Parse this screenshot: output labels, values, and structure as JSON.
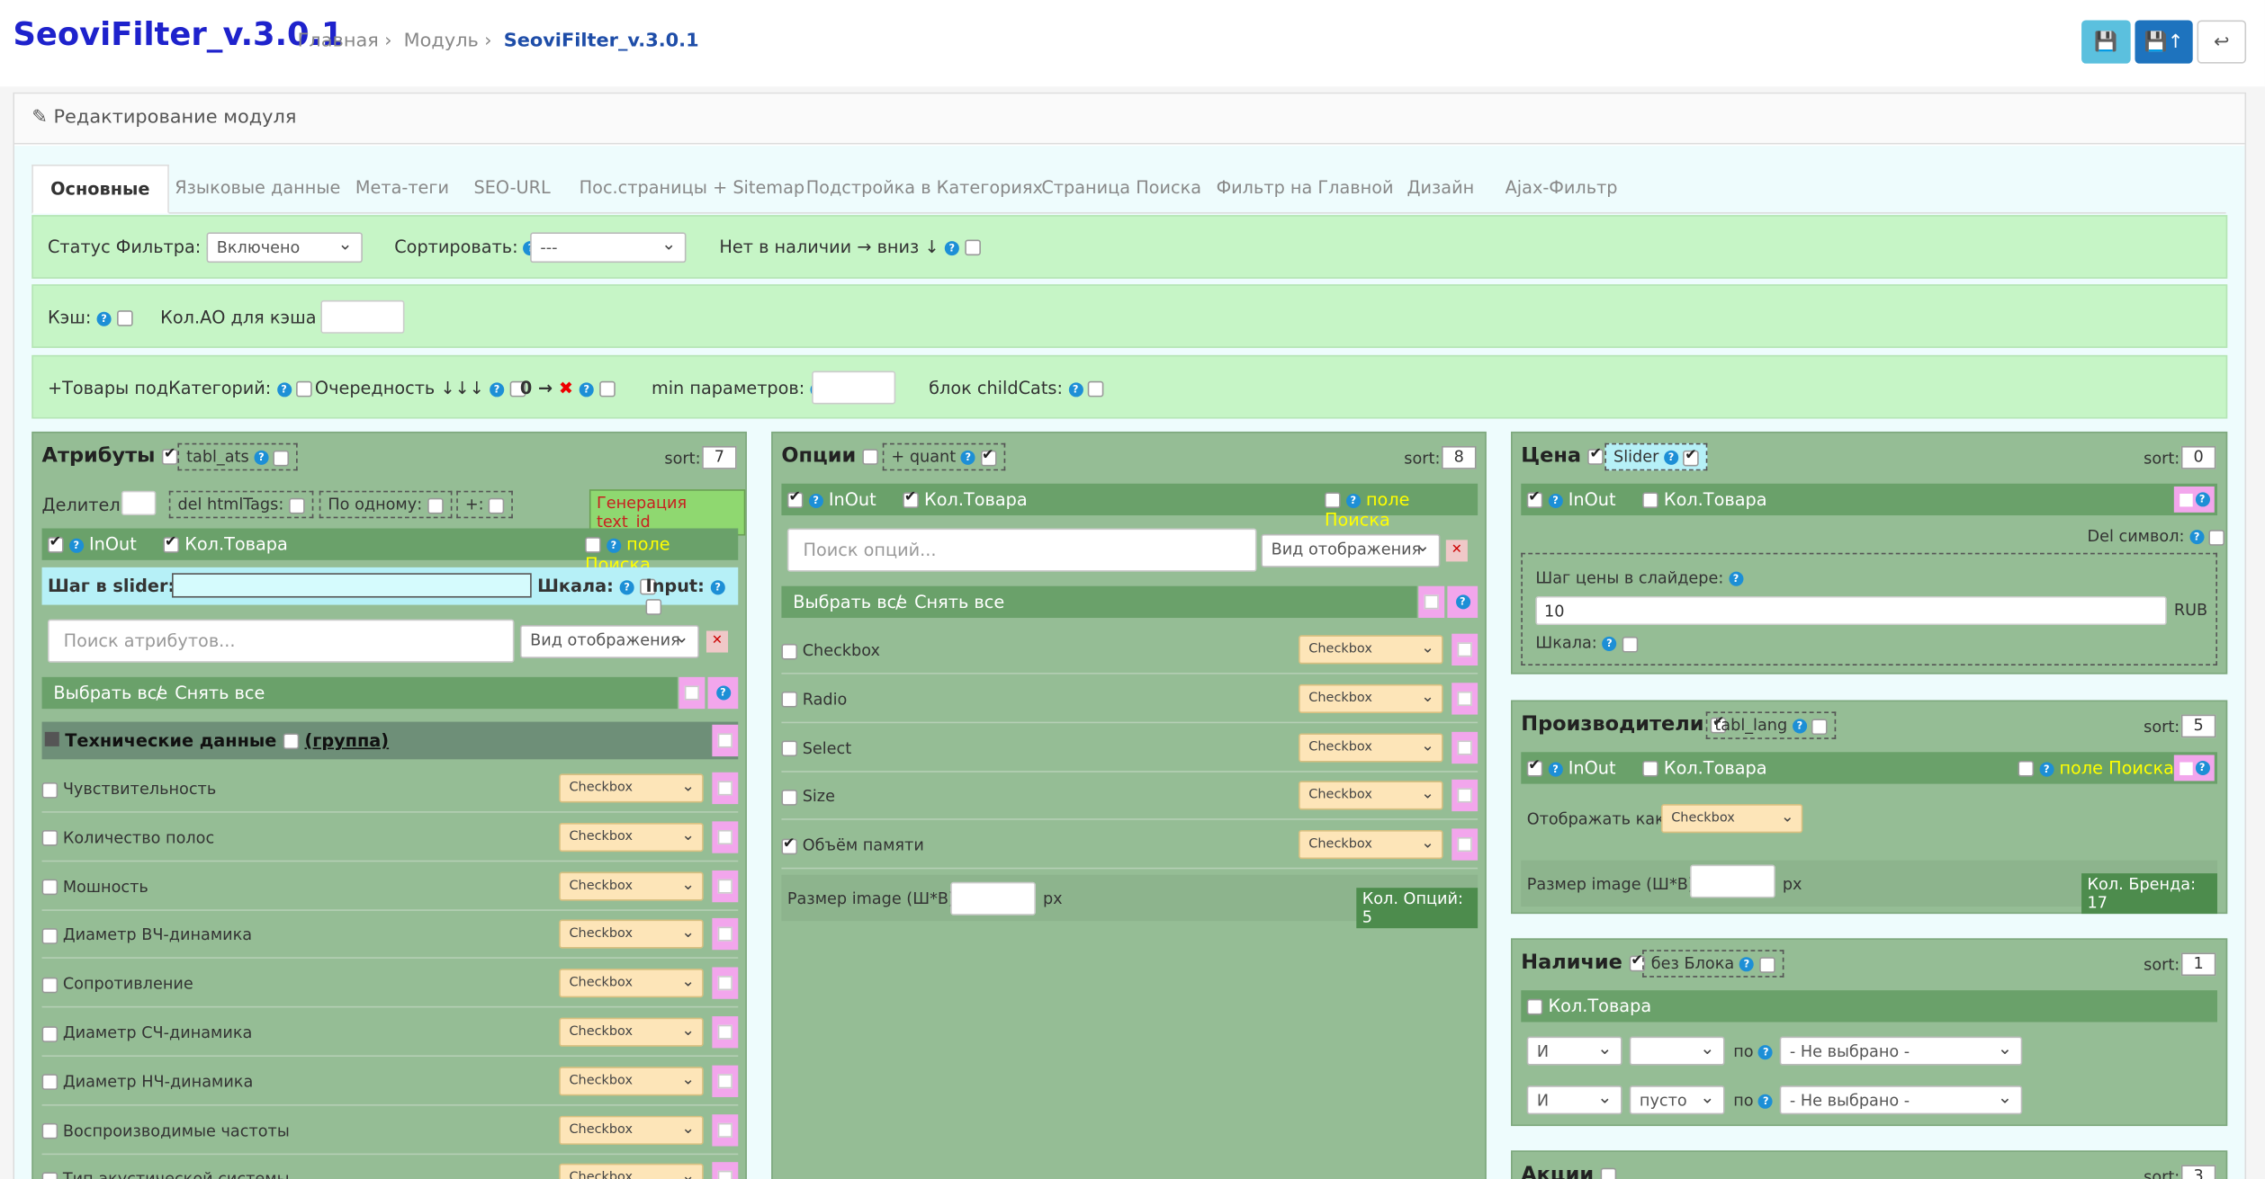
{
  "header": {
    "title": "SeoviFilter_v.3.0.1",
    "breadcrumbs": [
      "Главная",
      "Модуль",
      "SeoviFilter_v.3.0.1"
    ]
  },
  "panel": {
    "title": "Редактирование модуля"
  },
  "tabs": [
    "Основные",
    "Языковые данные",
    "Мета-теги",
    "SEO-URL",
    "Пос.страницы + Sitemap",
    "Подстройка в Категориях",
    "Страница Поиска",
    "Фильтр на Главной",
    "Дизайн",
    "Ajax-Фильтр"
  ],
  "settings": {
    "status_label": "Статус Фильтра:",
    "status_value": "Включено",
    "sort_label": "Сортировать:",
    "sort_value": "---",
    "out_of_stock_label": "Нет в наличии → вниз ↓",
    "cache_label": "Кэш:",
    "cache_count_label": "Кол.АО для кэша",
    "subcats_label": "+Товары подКатегорий:",
    "order_label": "Очередность ↓↓↓",
    "zero_label": "0 →",
    "min_params_label": "min параметров:",
    "child_cats_label": "блок childCats:"
  },
  "attributes": {
    "title": "Атрибуты",
    "tabl": "tabl_ats",
    "sort_label": "sort:",
    "sort": "7",
    "divider_label": "Делитель",
    "del_html": "del htmlTags:",
    "one_by_one": "По одному:",
    "plus": "+:",
    "gen_button": "Генерация text_id",
    "inout": "InOut",
    "count": "Кол.Товара",
    "search_field": "поле Поиска",
    "slider_step": "Шаг в slider:",
    "scale": "Шкала:",
    "input": "Input:",
    "search_placeholder": "Поиск атрибутов...",
    "view_placeholder": "Вид отображения",
    "select_all": "Выбрать все",
    "deselect_all": "Снять все",
    "group_name": "Технические данные",
    "group_label": "(группа)",
    "items": [
      {
        "name": "Чувствительность",
        "type": "Checkbox"
      },
      {
        "name": "Количество полос",
        "type": "Checkbox"
      },
      {
        "name": "Мошность",
        "type": "Checkbox"
      },
      {
        "name": "Диаметр ВЧ-динамика",
        "type": "Checkbox"
      },
      {
        "name": "Сопротивление",
        "type": "Checkbox"
      },
      {
        "name": "Диаметр СЧ-динамика",
        "type": "Checkbox"
      },
      {
        "name": "Диаметр НЧ-динамика",
        "type": "Checkbox"
      },
      {
        "name": "Воспроизводимые частоты",
        "type": "Checkbox"
      },
      {
        "name": "Тип акустической системы",
        "type": "Checkbox"
      }
    ]
  },
  "options": {
    "title": "Опции",
    "quant": "+ quant",
    "sort_label": "sort:",
    "sort": "8",
    "inout": "InOut",
    "count": "Кол.Товара",
    "search_field": "поле Поиска",
    "search_placeholder": "Поиск опций...",
    "view_placeholder": "Вид отображения",
    "select_all": "Выбрать все",
    "deselect_all": "Снять все",
    "items": [
      {
        "name": "Checkbox",
        "type": "Checkbox"
      },
      {
        "name": "Radio",
        "type": "Checkbox"
      },
      {
        "name": "Select",
        "type": "Checkbox"
      },
      {
        "name": "Size",
        "type": "Checkbox"
      },
      {
        "name": "Объём памяти",
        "type": "Checkbox"
      }
    ],
    "image_size": "Размер image (Ш*В):",
    "px": "px",
    "count_badge": "Кол. Опций: 5"
  },
  "price": {
    "title": "Цена",
    "slider": "Slider",
    "sort_label": "sort:",
    "sort": "0",
    "inout": "InOut",
    "count": "Кол.Товара",
    "del_symbol": "Del символ:",
    "step_label": "Шаг цены в слайдере:",
    "step_value": "10",
    "currency": "RUB",
    "scale": "Шкала:"
  },
  "manufacturers": {
    "title": "Производители",
    "tabl": "tabl_lang",
    "sort_label": "sort:",
    "sort": "5",
    "inout": "InOut",
    "count": "Кол.Товара",
    "search_field": "поле Поиска",
    "display_as": "Отображать как:",
    "display_value": "Checkbox",
    "image_size": "Размер image (Ш*В):",
    "px": "px",
    "brand_count": "Кол. Бренда: 17"
  },
  "stock": {
    "title": "Наличие",
    "no_block": "без Блока",
    "sort_label": "sort:",
    "sort": "1",
    "count": "Кол.Товара",
    "and1": "И",
    "and2": "И",
    "empty": "пусто",
    "by": "по",
    "not_selected": "- Не выбрано -"
  },
  "promo": {
    "title": "Акции",
    "sort_label": "sort:",
    "sort": "3"
  }
}
